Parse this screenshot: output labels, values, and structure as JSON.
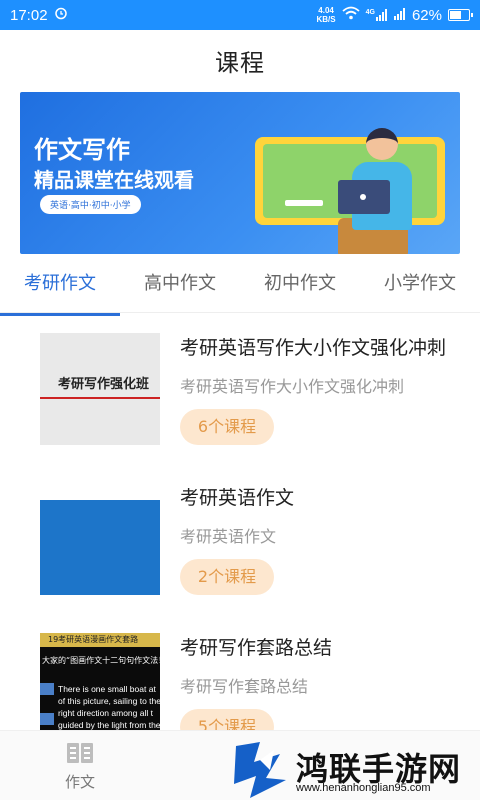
{
  "status_bar": {
    "time": "17:02",
    "net_speed_value": "4.04",
    "net_speed_unit": "KB/S",
    "signal_label": "4G",
    "battery_percent": "62%",
    "battery_level": 0.62
  },
  "header": {
    "title": "课程"
  },
  "banner": {
    "title": "作文写作",
    "subtitle": "精品课堂在线观看",
    "tag": "英语·高中·初中·小学"
  },
  "tabs": [
    {
      "label": "考研作文",
      "active": true
    },
    {
      "label": "高中作文",
      "active": false
    },
    {
      "label": "初中作文",
      "active": false
    },
    {
      "label": "小学作文",
      "active": false
    }
  ],
  "courses": [
    {
      "title": "考研英语写作大小作文强化冲刺",
      "desc": "考研英语写作大小作文强化冲刺",
      "count": "6个课程",
      "thumb_text": "考研写作强化班"
    },
    {
      "title": "考研英语作文",
      "desc": "考研英语作文",
      "count": "2个课程"
    },
    {
      "title": "考研写作套路总结",
      "desc": "考研写作套路总结",
      "count": "5个课程",
      "thumb_header": "19考研英语漫画作文套路",
      "thumb_sub": "大家的“图画作文十二句句作文法！”",
      "thumb_lines": [
        "There is one small boat at",
        "of this picture, sailing to the",
        "right direction among all t",
        "guided by the light from the"
      ]
    }
  ],
  "bottom_nav": {
    "item_label": "作文"
  },
  "watermark": {
    "text": "鸿联手游网",
    "url": "www.henanhonglian95.com"
  }
}
